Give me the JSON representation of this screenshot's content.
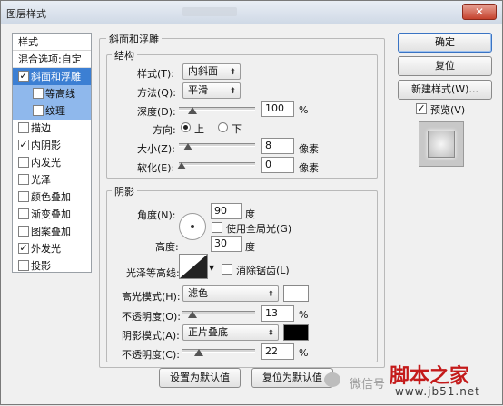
{
  "window": {
    "title": "图层样式",
    "close": "✕"
  },
  "left": {
    "header": "样式",
    "blend": "混合选项:自定",
    "items": [
      {
        "label": "斜面和浮雕",
        "checked": "✓"
      },
      {
        "label": "等高线",
        "checked": ""
      },
      {
        "label": "纹理",
        "checked": ""
      },
      {
        "label": "描边",
        "checked": ""
      },
      {
        "label": "内阴影",
        "checked": "✓"
      },
      {
        "label": "内发光",
        "checked": ""
      },
      {
        "label": "光泽",
        "checked": ""
      },
      {
        "label": "颜色叠加",
        "checked": ""
      },
      {
        "label": "渐变叠加",
        "checked": ""
      },
      {
        "label": "图案叠加",
        "checked": ""
      },
      {
        "label": "外发光",
        "checked": "✓"
      },
      {
        "label": "投影",
        "checked": ""
      }
    ]
  },
  "bevel": {
    "section": "斜面和浮雕",
    "structure": "结构",
    "style_label": "样式(T):",
    "style_value": "内斜面",
    "method_label": "方法(Q):",
    "method_value": "平滑",
    "depth_label": "深度(D):",
    "depth_value": "100",
    "depth_unit": "%",
    "direction_label": "方向:",
    "dir_up": "上",
    "dir_down": "下",
    "size_label": "大小(Z):",
    "size_value": "8",
    "size_unit": "像素",
    "soften_label": "软化(E):",
    "soften_value": "0",
    "soften_unit": "像素"
  },
  "shading": {
    "section": "阴影",
    "angle_label": "角度(N):",
    "angle_value": "90",
    "angle_unit": "度",
    "global_light": "使用全局光(G)",
    "altitude_label": "高度:",
    "altitude_value": "30",
    "altitude_unit": "度",
    "gloss_label": "光泽等高线:",
    "antialias": "消除锯齿(L)",
    "highlight_label": "高光模式(H):",
    "highlight_mode": "滤色",
    "highlight_color": "#ffffff",
    "op1_label": "不透明度(O):",
    "op1_value": "13",
    "op1_unit": "%",
    "shadow_label": "阴影模式(A):",
    "shadow_mode": "正片叠底",
    "shadow_color": "#000000",
    "op2_label": "不透明度(C):",
    "op2_value": "22",
    "op2_unit": "%"
  },
  "buttons": {
    "ok": "确定",
    "reset": "复位",
    "new_style": "新建样式(W)...",
    "preview": "预览(V)",
    "set_default": "设置为默认值",
    "reset_default": "复位为默认值"
  },
  "watermark": {
    "wechat": "微信号",
    "brand": "脚本之家",
    "url": "www.jb51.net"
  }
}
